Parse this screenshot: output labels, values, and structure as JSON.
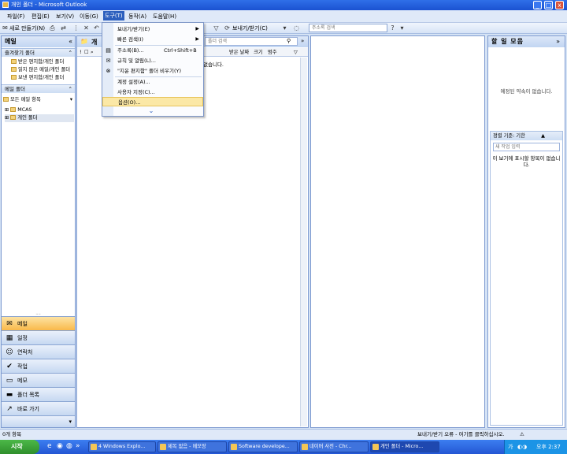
{
  "window": {
    "title": "개인 폴더 - Microsoft Outlook",
    "minimize_glyph": "_",
    "maximize_glyph": "□",
    "close_glyph": "x"
  },
  "menu": {
    "items": [
      "파일(F)",
      "편집(E)",
      "보기(V)",
      "이동(G)",
      "도구(T)",
      "동작(A)",
      "도움말(H)"
    ],
    "active_index": 4
  },
  "toolbar": {
    "new_label": "새로 만들기(N)",
    "send_receive_label": "보내기/받기(C)",
    "address_placeholder": "주소록 검색"
  },
  "dropdown": {
    "items": [
      {
        "label": "보내기/받기(E)",
        "shortcut": "",
        "submenu": true,
        "icon": ""
      },
      {
        "label": "빠른 검색(I)",
        "shortcut": "",
        "submenu": true,
        "icon": ""
      },
      {
        "label": "주소록(B)...",
        "shortcut": "Ctrl+Shift+B",
        "submenu": false,
        "icon": "address-book-icon"
      },
      {
        "label": "규칙 및 알림(L)...",
        "shortcut": "",
        "submenu": false,
        "icon": "rules-icon"
      },
      {
        "label": "\"지운 편지함\" 폴더 비우기(Y)",
        "shortcut": "",
        "submenu": false,
        "icon": "empty-deleted-icon"
      },
      {
        "label": "계정 설정(A)...",
        "shortcut": "",
        "submenu": false,
        "icon": ""
      },
      {
        "label": "사용자 지정(C)...",
        "shortcut": "",
        "submenu": false,
        "icon": ""
      },
      {
        "label": "옵션(O)...",
        "shortcut": "",
        "submenu": false,
        "icon": ""
      }
    ],
    "highlighted_index": 7
  },
  "nav": {
    "title": "메일",
    "favorites_header": "즐겨찾기 폴더",
    "favorites": [
      "받은 편지함/개인 폴더",
      "읽지 않은 메일/개인 폴더",
      "보낸 편지함/개인 폴더"
    ],
    "mail_folders_header": "메일 폴더",
    "all_mail_label": "모든 메일 항목",
    "tree": [
      "MCAS",
      "개인 폴더"
    ],
    "buttons": [
      "메일",
      "일정",
      "연락처",
      "작업",
      "메모",
      "폴더 목록",
      "바로 가기"
    ],
    "selected_button": 0
  },
  "list": {
    "title": "개",
    "search_placeholder": "폴더 검색",
    "col_received": "받은 날짜",
    "col_size": "크기",
    "col_category": "범주",
    "empty_text": "없습니다."
  },
  "todo": {
    "title": "할 일 모음",
    "appointment_note": "예정된 약속이 없습니다.",
    "sort_label": "정렬 기준: 기한",
    "new_task_placeholder": "새 작업 입력",
    "empty_tasks": "이 보기에 표시할 항목이 없습니다."
  },
  "status": {
    "left": "0개 항목",
    "right": "보내기/받기 오류 - 여기를 클릭하십시오."
  },
  "taskbar": {
    "start_label": "시작",
    "tasks": [
      "4 Windows Explo...",
      "제목 없음 - 메모장",
      "Software develope...",
      "네이버 사전 - Chr...",
      "개인 폴더 - Micro..."
    ],
    "active_task": 4,
    "clock": "오후 2:37"
  }
}
